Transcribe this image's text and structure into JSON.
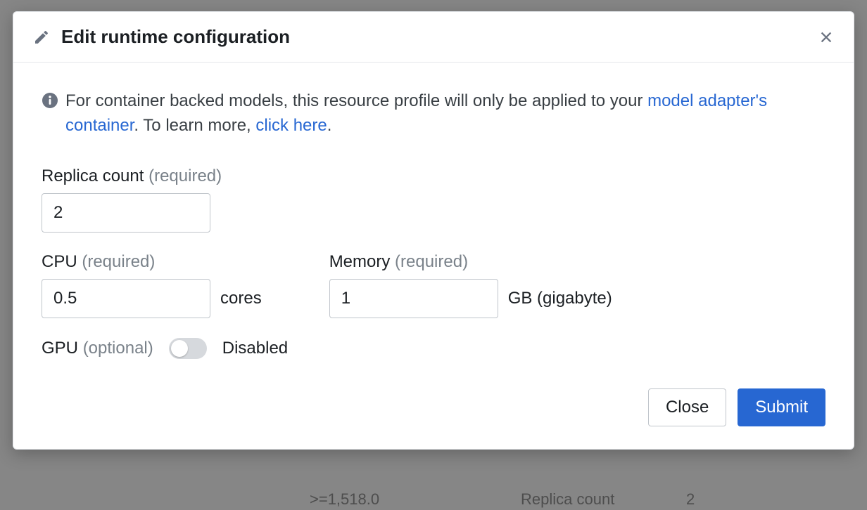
{
  "modal": {
    "title": "Edit runtime configuration"
  },
  "info": {
    "prefix": "For container backed models, this resource profile will only be applied to your ",
    "link1": "model adapter's container",
    "middle": ". To learn more, ",
    "link2": "click here",
    "suffix": "."
  },
  "fields": {
    "replica": {
      "label": "Replica count",
      "req": "(required)",
      "value": "2"
    },
    "cpu": {
      "label": "CPU",
      "req": "(required)",
      "value": "0.5",
      "unit": "cores"
    },
    "memory": {
      "label": "Memory",
      "req": "(required)",
      "value": "1",
      "unit": "GB (gigabyte)"
    },
    "gpu": {
      "label": "GPU",
      "req": "(optional)",
      "status": "Disabled"
    }
  },
  "footer": {
    "close": "Close",
    "submit": "Submit"
  },
  "backdrop": {
    "bottom_version": ">=1,518.0",
    "bottom_label": "Replica count",
    "bottom_value": "2"
  }
}
